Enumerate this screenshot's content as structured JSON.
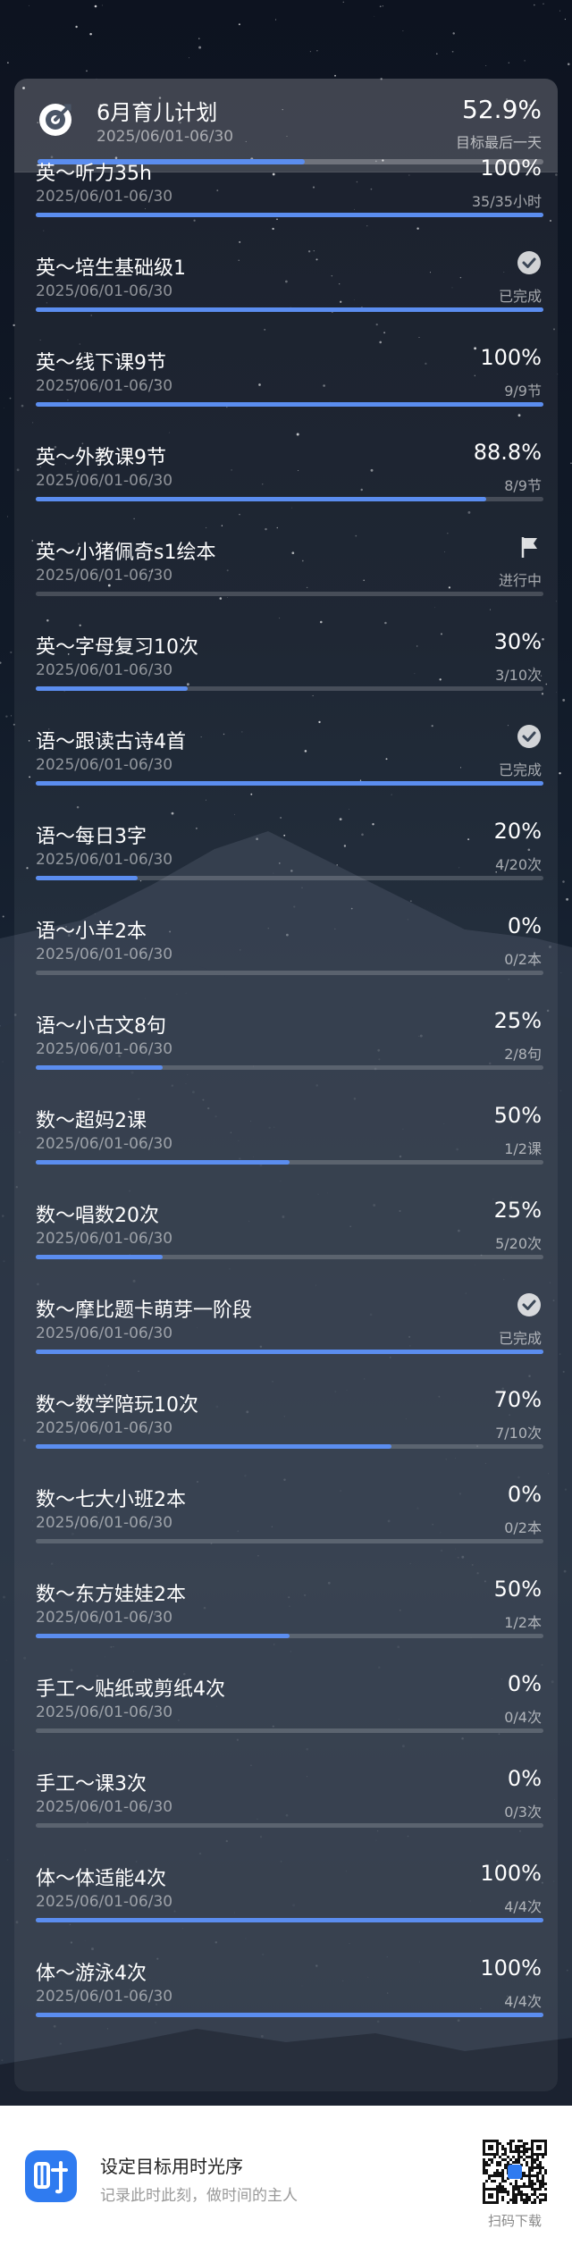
{
  "header": {
    "title": "6月育儿计划",
    "range": "2025/06/01-06/30",
    "percent": "52.9%",
    "sub": "目标最后一天",
    "progress": 0.529
  },
  "items": [
    {
      "name": "英～听力35h",
      "date": "2025/06/01-06/30",
      "percent": "100%",
      "count": "35/35小时",
      "progress": 1.0,
      "status": ""
    },
    {
      "name": "英～培生基础级1",
      "date": "2025/06/01-06/30",
      "percent": "",
      "count": "已完成",
      "progress": 1.0,
      "status": "check-icon"
    },
    {
      "name": "英～线下课9节",
      "date": "2025/06/01-06/30",
      "percent": "100%",
      "count": "9/9节",
      "progress": 1.0,
      "status": ""
    },
    {
      "name": "英～外教课9节",
      "date": "2025/06/01-06/30",
      "percent": "88.8%",
      "count": "8/9节",
      "progress": 0.888,
      "status": ""
    },
    {
      "name": "英～小猪佩奇s1绘本",
      "date": "2025/06/01-06/30",
      "percent": "",
      "count": "进行中",
      "progress": 0,
      "status": "flag-icon"
    },
    {
      "name": "英～字母复习10次",
      "date": "2025/06/01-06/30",
      "percent": "30%",
      "count": "3/10次",
      "progress": 0.3,
      "status": ""
    },
    {
      "name": "语～跟读古诗4首",
      "date": "2025/06/01-06/30",
      "percent": "",
      "count": "已完成",
      "progress": 1.0,
      "status": "check-icon"
    },
    {
      "name": "语～每日3字",
      "date": "2025/06/01-06/30",
      "percent": "20%",
      "count": "4/20次",
      "progress": 0.2,
      "status": ""
    },
    {
      "name": "语～小羊2本",
      "date": "2025/06/01-06/30",
      "percent": "0%",
      "count": "0/2本",
      "progress": 0,
      "status": ""
    },
    {
      "name": "语～小古文8句",
      "date": "2025/06/01-06/30",
      "percent": "25%",
      "count": "2/8句",
      "progress": 0.25,
      "status": ""
    },
    {
      "name": "数～超妈2课",
      "date": "2025/06/01-06/30",
      "percent": "50%",
      "count": "1/2课",
      "progress": 0.5,
      "status": ""
    },
    {
      "name": "数～唱数20次",
      "date": "2025/06/01-06/30",
      "percent": "25%",
      "count": "5/20次",
      "progress": 0.25,
      "status": ""
    },
    {
      "name": "数～摩比题卡萌芽一阶段",
      "date": "2025/06/01-06/30",
      "percent": "",
      "count": "已完成",
      "progress": 1.0,
      "status": "check-icon"
    },
    {
      "name": "数～数学陪玩10次",
      "date": "2025/06/01-06/30",
      "percent": "70%",
      "count": "7/10次",
      "progress": 0.7,
      "status": ""
    },
    {
      "name": "数～七大小班2本",
      "date": "2025/06/01-06/30",
      "percent": "0%",
      "count": "0/2本",
      "progress": 0,
      "status": ""
    },
    {
      "name": "数～东方娃娃2本",
      "date": "2025/06/01-06/30",
      "percent": "50%",
      "count": "1/2本",
      "progress": 0.5,
      "status": ""
    },
    {
      "name": "手工～贴纸或剪纸4次",
      "date": "2025/06/01-06/30",
      "percent": "0%",
      "count": "0/4次",
      "progress": 0,
      "status": ""
    },
    {
      "name": "手工～课3次",
      "date": "2025/06/01-06/30",
      "percent": "0%",
      "count": "0/3次",
      "progress": 0,
      "status": ""
    },
    {
      "name": "体～体适能4次",
      "date": "2025/06/01-06/30",
      "percent": "100%",
      "count": "4/4次",
      "progress": 1.0,
      "status": ""
    },
    {
      "name": "体～游泳4次",
      "date": "2025/06/01-06/30",
      "percent": "100%",
      "count": "4/4次",
      "progress": 1.0,
      "status": ""
    }
  ],
  "footer": {
    "title": "设定目标用时光序",
    "subtitle": "记录此时此刻，做时间的主人",
    "qr_label": "扫码下载"
  },
  "colors": {
    "accent": "#5b8def",
    "app_icon": "#2f7bf0"
  }
}
